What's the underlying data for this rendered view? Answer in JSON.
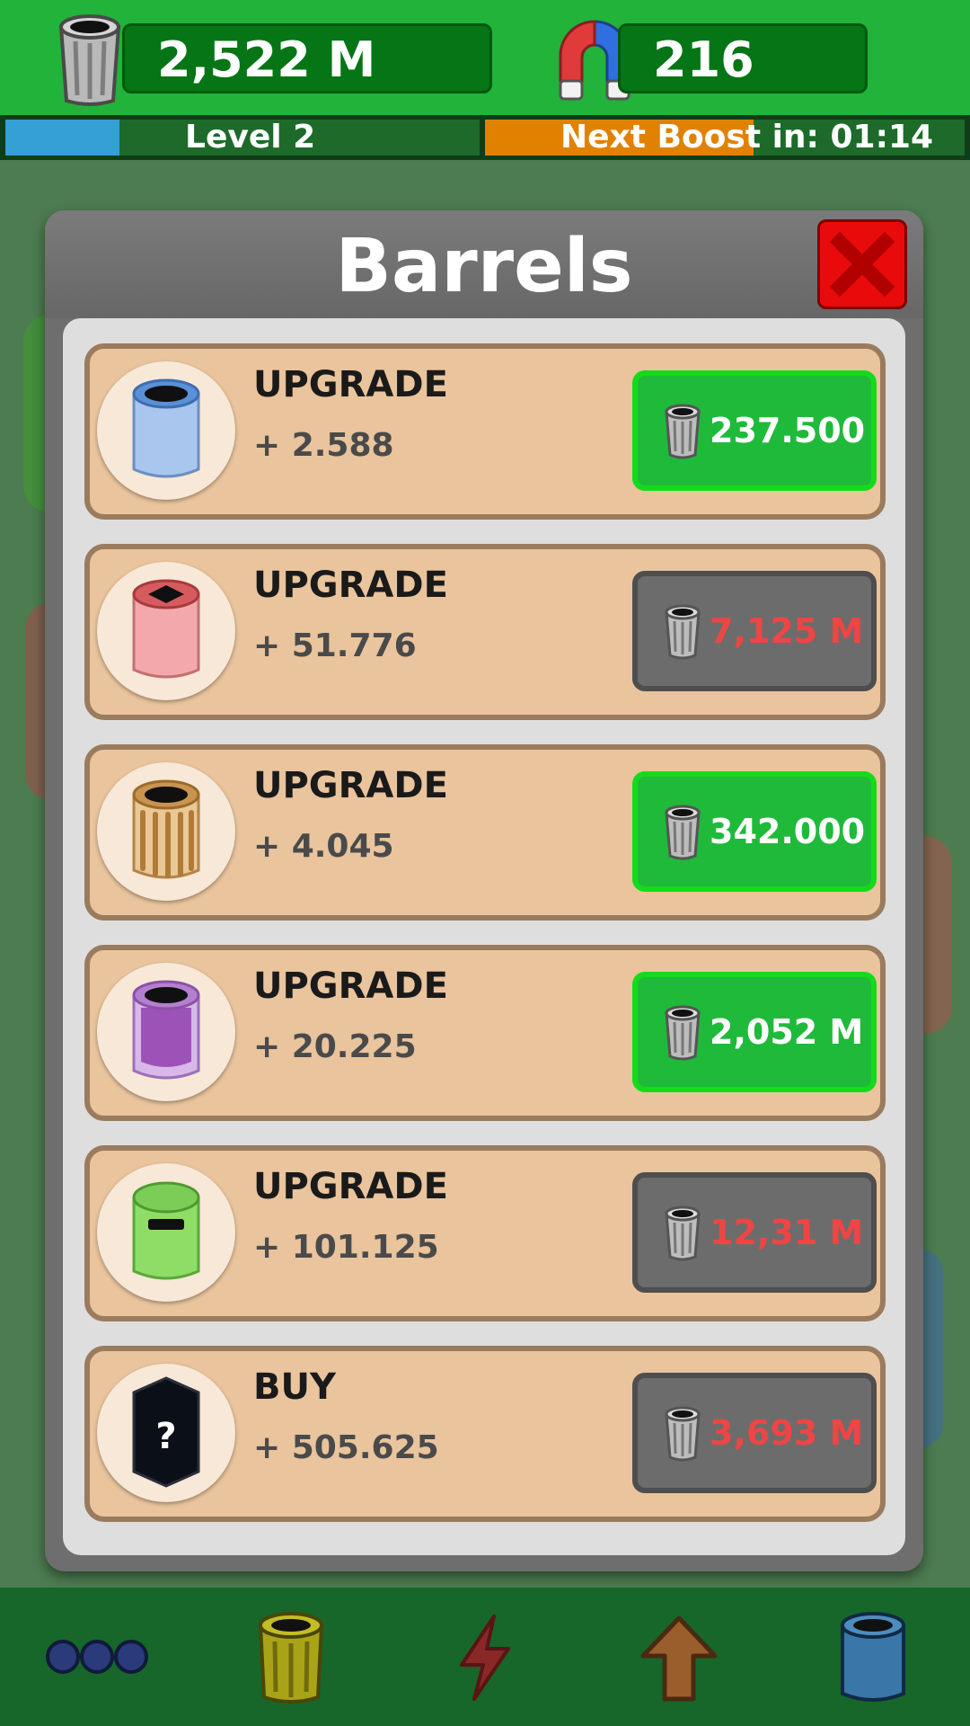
{
  "header": {
    "trash_count": "2,522 M",
    "magnet_count": "216",
    "level_label": "Level 2",
    "level_progress": 0.24,
    "boost_label": "Next Boost in: 01:14",
    "boost_progress": 0.56
  },
  "modal": {
    "title": "Barrels",
    "items": [
      {
        "action": "UPGRADE",
        "bonus": "+ 2.588",
        "price": "237.500",
        "affordable": true,
        "barrel": "blue-barrel-icon"
      },
      {
        "action": "UPGRADE",
        "bonus": "+ 51.776",
        "price": "7,125 M",
        "affordable": false,
        "barrel": "pink-barrel-icon"
      },
      {
        "action": "UPGRADE",
        "bonus": "+ 4.045",
        "price": "342.000",
        "affordable": true,
        "barrel": "wooden-barrel-icon"
      },
      {
        "action": "UPGRADE",
        "bonus": "+ 20.225",
        "price": "2,052 M",
        "affordable": true,
        "barrel": "purple-barrel-icon"
      },
      {
        "action": "UPGRADE",
        "bonus": "+ 101.125",
        "price": "12,31 M",
        "affordable": false,
        "barrel": "green-bin-icon"
      },
      {
        "action": "BUY",
        "bonus": "+ 505.625",
        "price": "3,693 M",
        "affordable": false,
        "barrel": "mystery-barrel-icon",
        "mystery_glyph": "?"
      }
    ]
  },
  "bottom_nav": [
    "more-icon",
    "barrel-icon",
    "lightning-icon",
    "upgrade-arrow-icon",
    "blue-barrel-icon"
  ],
  "colors": {
    "top_bar": "#22b33a",
    "counter_box": "#057515",
    "affordable_button": "#1fba3a",
    "unaffordable_button": "#6c6c6c",
    "unaffordable_price": "#ee4545",
    "close_button": "#e90b0b",
    "item_card": "#e9c49d"
  }
}
